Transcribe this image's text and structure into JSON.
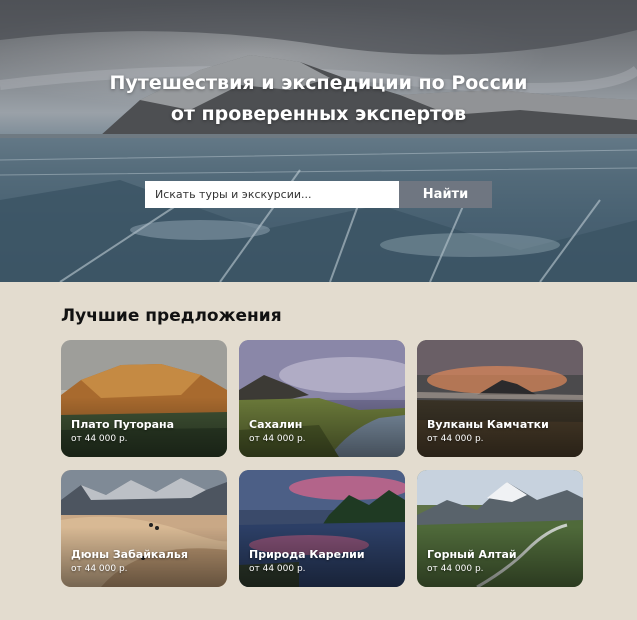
{
  "hero": {
    "title_line1": "Путешествия и экспедиции по России",
    "title_line2": "от проверенных экспертов",
    "search_placeholder": "Искать туры и экскурсии...",
    "search_button": "Найти"
  },
  "offers": {
    "title": "Лучшие предложения",
    "cards": [
      {
        "name": "Плато Путорана",
        "price": "от 44 000 р."
      },
      {
        "name": "Сахалин",
        "price": "от 44 000 р."
      },
      {
        "name": "Вулканы Камчатки",
        "price": "от 44 000 р."
      },
      {
        "name": "Дюны Забайкалья",
        "price": "от 44 000 р."
      },
      {
        "name": "Природа Карелии",
        "price": "от 44 000 р."
      },
      {
        "name": "Горный Алтай",
        "price": "от 44 000 р."
      }
    ]
  }
}
